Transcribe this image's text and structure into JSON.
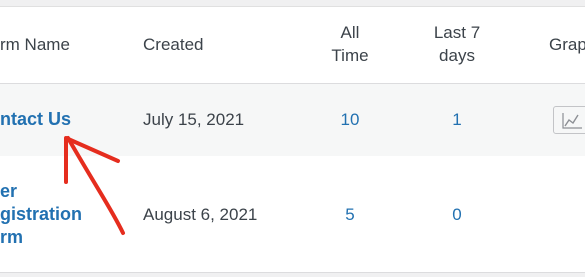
{
  "table": {
    "columns": {
      "form_name": "rm Name",
      "created": "Created",
      "all_time_1": "All",
      "all_time_2": "Time",
      "last7_1": "Last 7",
      "last7_2": "days",
      "graph": "Grap"
    },
    "rows": [
      {
        "name": "ntact Us",
        "created": "July 15, 2021",
        "all_time": "10",
        "last7": "1"
      },
      {
        "name_1": "er",
        "name_2": "gistration",
        "name_3": "rm",
        "created": "August 6, 2021",
        "all_time": "5",
        "last7": "0"
      }
    ]
  },
  "icons": {
    "graph": "line-chart-icon",
    "annotation": "red-arrow"
  },
  "colors": {
    "link": "#2271b1",
    "arrow": "#e52d1e",
    "row_alt": "#f6f7f7"
  }
}
